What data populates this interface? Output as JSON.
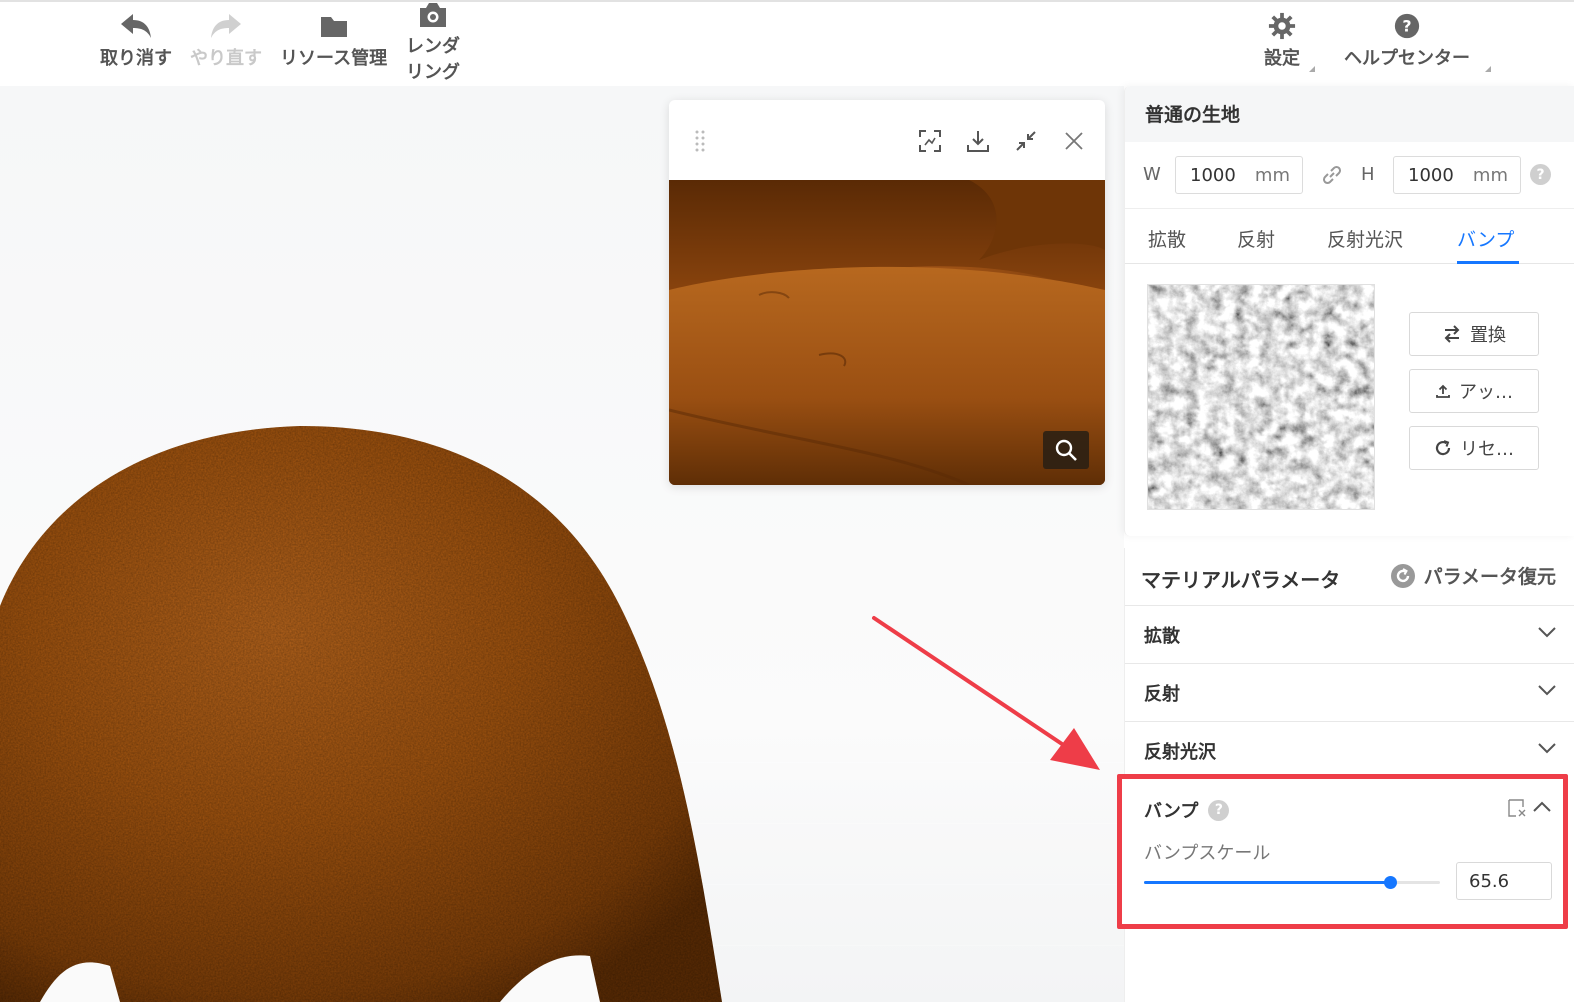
{
  "toolbar": {
    "undo": "取り消す",
    "redo": "やり直す",
    "resources": "リソース管理",
    "render_line1": "レンダ",
    "render_line2": "リング",
    "settings": "設定",
    "help": "ヘルプセンター"
  },
  "icons": {
    "undo": "undo-icon",
    "redo": "redo-icon",
    "folder": "folder-icon",
    "camera": "camera-icon",
    "gear": "gear-icon",
    "help": "question-circle-icon"
  },
  "material": {
    "name": "普通の生地",
    "width_label": "W",
    "width_value": "1000",
    "height_label": "H",
    "height_value": "1000",
    "unit": "mm",
    "tabs": [
      "拡散",
      "反射",
      "反射光沢",
      "バンプ"
    ],
    "active_tab": "バンプ",
    "buttons": {
      "replace": "置換",
      "upload": "アッ…",
      "reset": "リセ…"
    }
  },
  "params": {
    "title": "マテリアルパラメータ",
    "restore": "パラメータ復元",
    "sections": [
      "拡散",
      "反射",
      "反射光沢"
    ],
    "bump": {
      "title": "バンプ",
      "scale_label": "バンプスケール",
      "scale_value": "65.6",
      "slider_fraction": 0.83
    }
  },
  "colors": {
    "accent": "#1677ff",
    "highlight": "#ee3d48",
    "fabric": "#9a4f14"
  }
}
